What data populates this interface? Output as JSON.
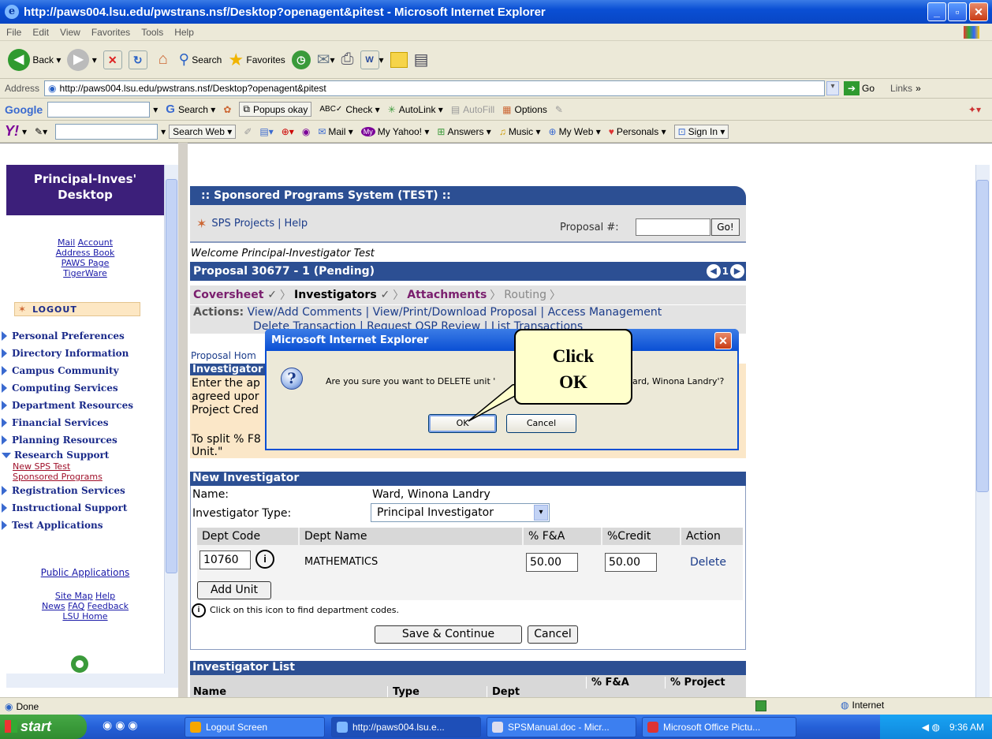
{
  "window": {
    "title": "http://paws004.lsu.edu/pwstrans.nsf/Desktop?openagent&pitest - Microsoft Internet Explorer"
  },
  "menu": [
    "File",
    "Edit",
    "View",
    "Favorites",
    "Tools",
    "Help"
  ],
  "toolbar": {
    "back": "Back",
    "search": "Search",
    "favorites": "Favorites"
  },
  "address": {
    "label": "Address",
    "url": "http://paws004.lsu.edu/pwstrans.nsf/Desktop?openagent&pitest",
    "go": "Go",
    "links": "Links"
  },
  "google": {
    "logo": "Google",
    "search": "Search",
    "popups": "Popups okay",
    "check": "Check",
    "autolink": "AutoLink",
    "autofill": "AutoFill",
    "options": "Options"
  },
  "yahoo": {
    "logo": "Y!",
    "search": "Search Web",
    "mail": "Mail",
    "myyahoo": "My Yahoo!",
    "answers": "Answers",
    "music": "Music",
    "myweb": "My Web",
    "personals": "Personals",
    "signin": "Sign In"
  },
  "sidebar": {
    "title_line1": "Principal-Inves'",
    "title_line2": "Desktop",
    "links_row1": [
      "Mail",
      "Account"
    ],
    "links_rows": [
      "Address Book",
      "PAWS Page",
      "TigerWare"
    ],
    "logout": "LOGOUT",
    "nav": [
      "Personal Preferences",
      "Directory Information",
      "Campus Community",
      "Computing Services",
      "Department Resources",
      "Financial Services",
      "Planning Resources"
    ],
    "research": "Research Support",
    "research_sub": [
      "New SPS Test",
      "Sponsored Programs"
    ],
    "nav2": [
      "Registration Services",
      "Instructional Support",
      "Test Applications"
    ],
    "public_apps": "Public Applications",
    "footer_row1": [
      "Site Map",
      "Help"
    ],
    "footer_row2": [
      "News",
      "FAQ",
      "Feedback"
    ],
    "footer_row3": "LSU Home"
  },
  "sps": {
    "header": ":: Sponsored Programs System (TEST) ::",
    "projects": "SPS Projects",
    "help": "Help",
    "proposal_label": "Proposal #:",
    "go": "Go!",
    "welcome": "Welcome Principal-Investigator Test",
    "proposal_title": "Proposal 30677 - 1 (Pending)",
    "page_num": "1",
    "tabs": [
      "Coversheet",
      "Investigators",
      "Attachments",
      "Routing"
    ],
    "actions_label": "Actions:",
    "actions": [
      "View/Add Comments",
      "View/Print/Download Proposal",
      "Access Management"
    ],
    "actions_row2": [
      "Delete Transaction",
      "Request OSP Review",
      "List Transactions"
    ],
    "proposal_home": "Proposal Hom",
    "inv_head": "Investigator",
    "inv_text": [
      "Enter the ap",
      "agreed upor",
      "Project Cred",
      "To split % F8",
      "Unit.\""
    ]
  },
  "new_inv": {
    "header": "New Investigator",
    "name_label": "Name:",
    "name_value": "Ward, Winona Landry",
    "type_label": "Investigator Type:",
    "type_value": "Principal Investigator",
    "cols": [
      "Dept Code",
      "Dept Name",
      "% F&A",
      "%Credit",
      "Action"
    ],
    "row": {
      "code": "10760",
      "name": "MATHEMATICS",
      "fa": "50.00",
      "credit": "50.00",
      "action": "Delete"
    },
    "add_unit": "Add Unit",
    "hint": "Click on this icon to find department codes.",
    "save": "Save & Continue",
    "cancel": "Cancel"
  },
  "inv_list": {
    "header": "Investigator List",
    "cols": [
      "Name",
      "Type",
      "Dept",
      "% F&A",
      "% Project"
    ]
  },
  "dialog": {
    "title": "Microsoft Internet Explorer",
    "message": "Are you sure you want to DELETE unit '",
    "message_end": "ard, Winona Landry'?",
    "ok": "OK",
    "cancel": "Cancel"
  },
  "callout": {
    "line1": "Click",
    "line2": "OK"
  },
  "status": {
    "left": "Done",
    "zone": "Internet"
  },
  "taskbar": {
    "start": "start",
    "tasks": [
      "Logout Screen",
      "http://paws004.lsu.e...",
      "SPSManual.doc - Micr...",
      "Microsoft Office Pictu..."
    ],
    "time": "9:36 AM"
  }
}
